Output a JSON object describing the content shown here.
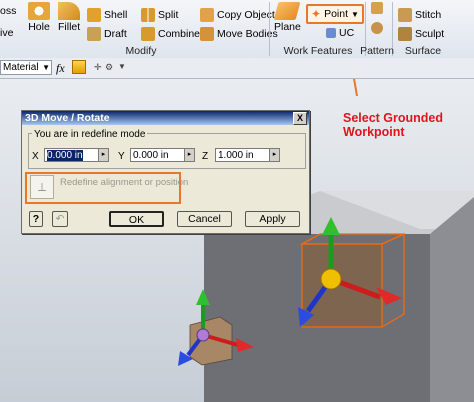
{
  "ribbon": {
    "cut_left": "oss",
    "cut_left2": "ive",
    "hole": "Hole",
    "fillet": "Fillet",
    "shell": "Shell",
    "draft": "Draft",
    "split": "Split",
    "combine": "Combine",
    "copy_object": "Copy Object",
    "move_bodies": "Move Bodies",
    "plane": "Plane",
    "point": "Point",
    "ucs": "UC",
    "stitch": "Stitch",
    "sculpt": "Sculpt",
    "panels": {
      "modify": "Modify",
      "work_features": "Work Features",
      "pattern": "Pattern",
      "surface": "Surface"
    }
  },
  "formula_bar": {
    "material": "Material",
    "fx": "fx"
  },
  "dialog": {
    "title": "3D Move / Rotate",
    "close": "X",
    "mode_label": "You are in redefine mode",
    "x_label": "X",
    "x_value": "0.000 in",
    "y_label": "Y",
    "y_value": "0.000 in",
    "z_label": "Z",
    "z_value": "1.000 in",
    "redefine_text": "Redefine alignment or position",
    "ok": "OK",
    "cancel": "Cancel",
    "apply": "Apply",
    "help": "?"
  },
  "callout": {
    "line1": "Select Grounded",
    "line2": "Workpoint"
  },
  "colors": {
    "accent": "#e8762b",
    "callout": "#e0141e"
  }
}
